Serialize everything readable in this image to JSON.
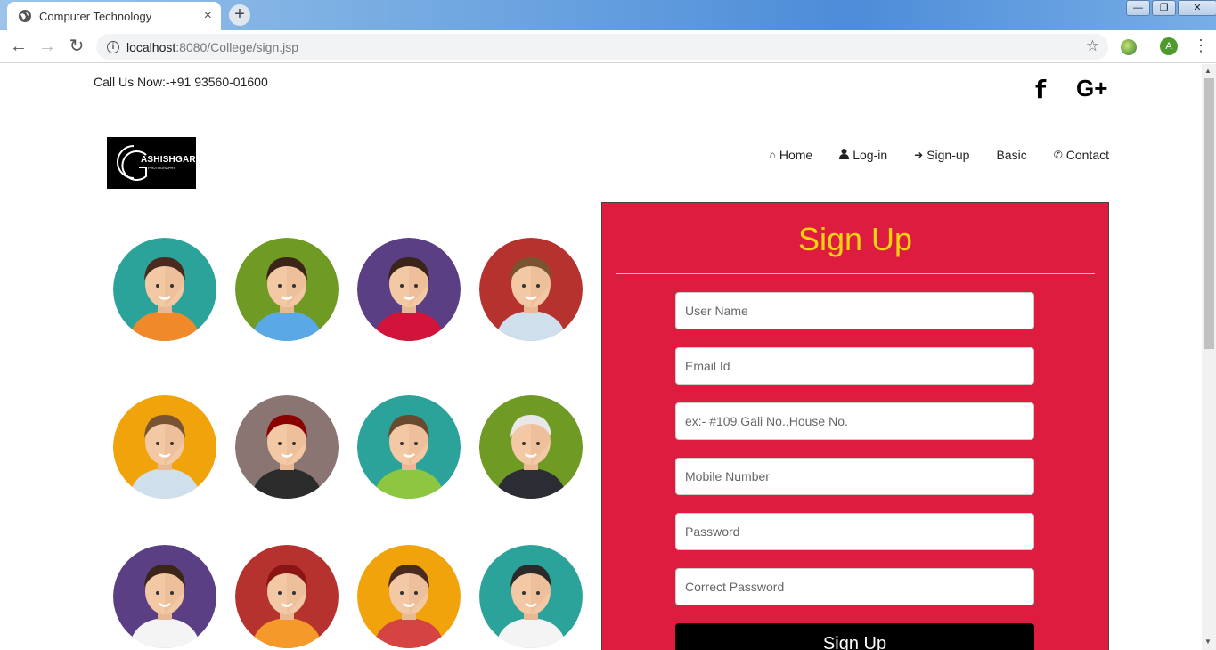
{
  "browser": {
    "tab_title": "Computer Technology",
    "tab_close": "×",
    "new_tab": "+",
    "url_host": "localhost",
    "url_rest": ":8080/College/sign.jsp",
    "profile_initial": "A",
    "window_controls": [
      "—",
      "❐",
      "✕"
    ]
  },
  "header": {
    "call_now": "Call Us Now:-+91 93560-01600",
    "social": {
      "facebook": "f",
      "google_plus": "G+"
    }
  },
  "logo": {
    "text": "ASHISHGARG",
    "subtext": "PHOTOGRAPHY",
    "monogram": "CG"
  },
  "nav": {
    "items": [
      {
        "label": "Home",
        "icon": "home-icon",
        "glyph": "⌂"
      },
      {
        "label": "Log-in",
        "icon": "user-icon",
        "glyph": "👤"
      },
      {
        "label": "Sign-up",
        "icon": "sign-in-icon",
        "glyph": "➜"
      },
      {
        "label": "Basic",
        "icon": "",
        "glyph": ""
      },
      {
        "label": "Contact",
        "icon": "phone-icon",
        "glyph": "✆"
      }
    ]
  },
  "signup": {
    "title": "Sign Up",
    "fields": [
      {
        "placeholder": "User Name"
      },
      {
        "placeholder": "Email Id"
      },
      {
        "placeholder": "ex:- #109,Gali No.,House No."
      },
      {
        "placeholder": "Mobile Number"
      },
      {
        "placeholder": "Password"
      },
      {
        "placeholder": "Correct Password"
      }
    ],
    "button": "Sign Up"
  },
  "colors": {
    "panel": "#dd1c3f",
    "title": "#f5d312",
    "avatar_backgrounds": [
      "#2ba39a",
      "#6f9a24",
      "#5b3f85",
      "#b6322e",
      "#f0a30a",
      "#8a7572",
      "#2ba39a",
      "#6f9a24",
      "#5b3f85",
      "#b6322e",
      "#f0a30a",
      "#2ba39a"
    ]
  }
}
